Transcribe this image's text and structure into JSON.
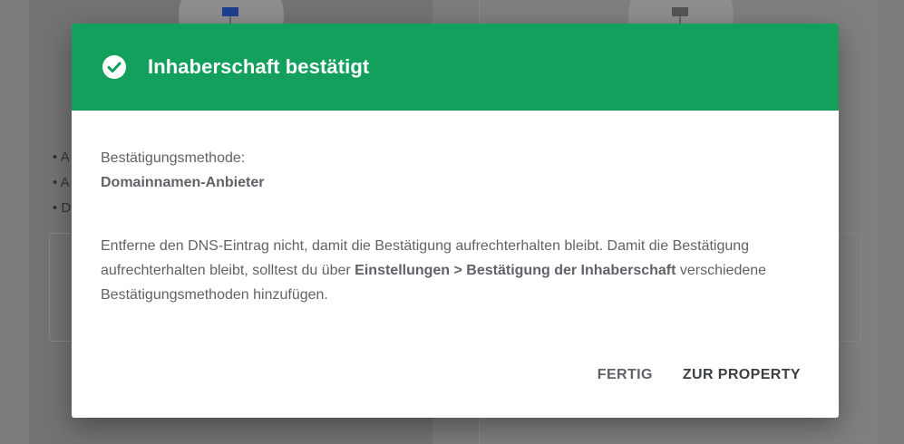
{
  "background": {
    "bullets": [
      "A",
      "A",
      "D"
    ]
  },
  "dialog": {
    "title": "Inhaberschaft bestätigt",
    "header_color": "#12a05c",
    "method_label": "Bestätigungsmethode:",
    "method_value": "Domainnamen-Anbieter",
    "message_part1": "Entferne den DNS-Eintrag nicht, damit die Bestätigung aufrechterhalten bleibt. Damit die Bestätigung aufrechterhalten bleibt, solltest du über ",
    "message_bold": "Einstellungen > Bestätigung der Inhaberschaft",
    "message_part2": " verschiedene Bestätigungsmethoden hinzufügen.",
    "buttons": {
      "done": "FERTIG",
      "to_property": "ZUR PROPERTY"
    }
  }
}
